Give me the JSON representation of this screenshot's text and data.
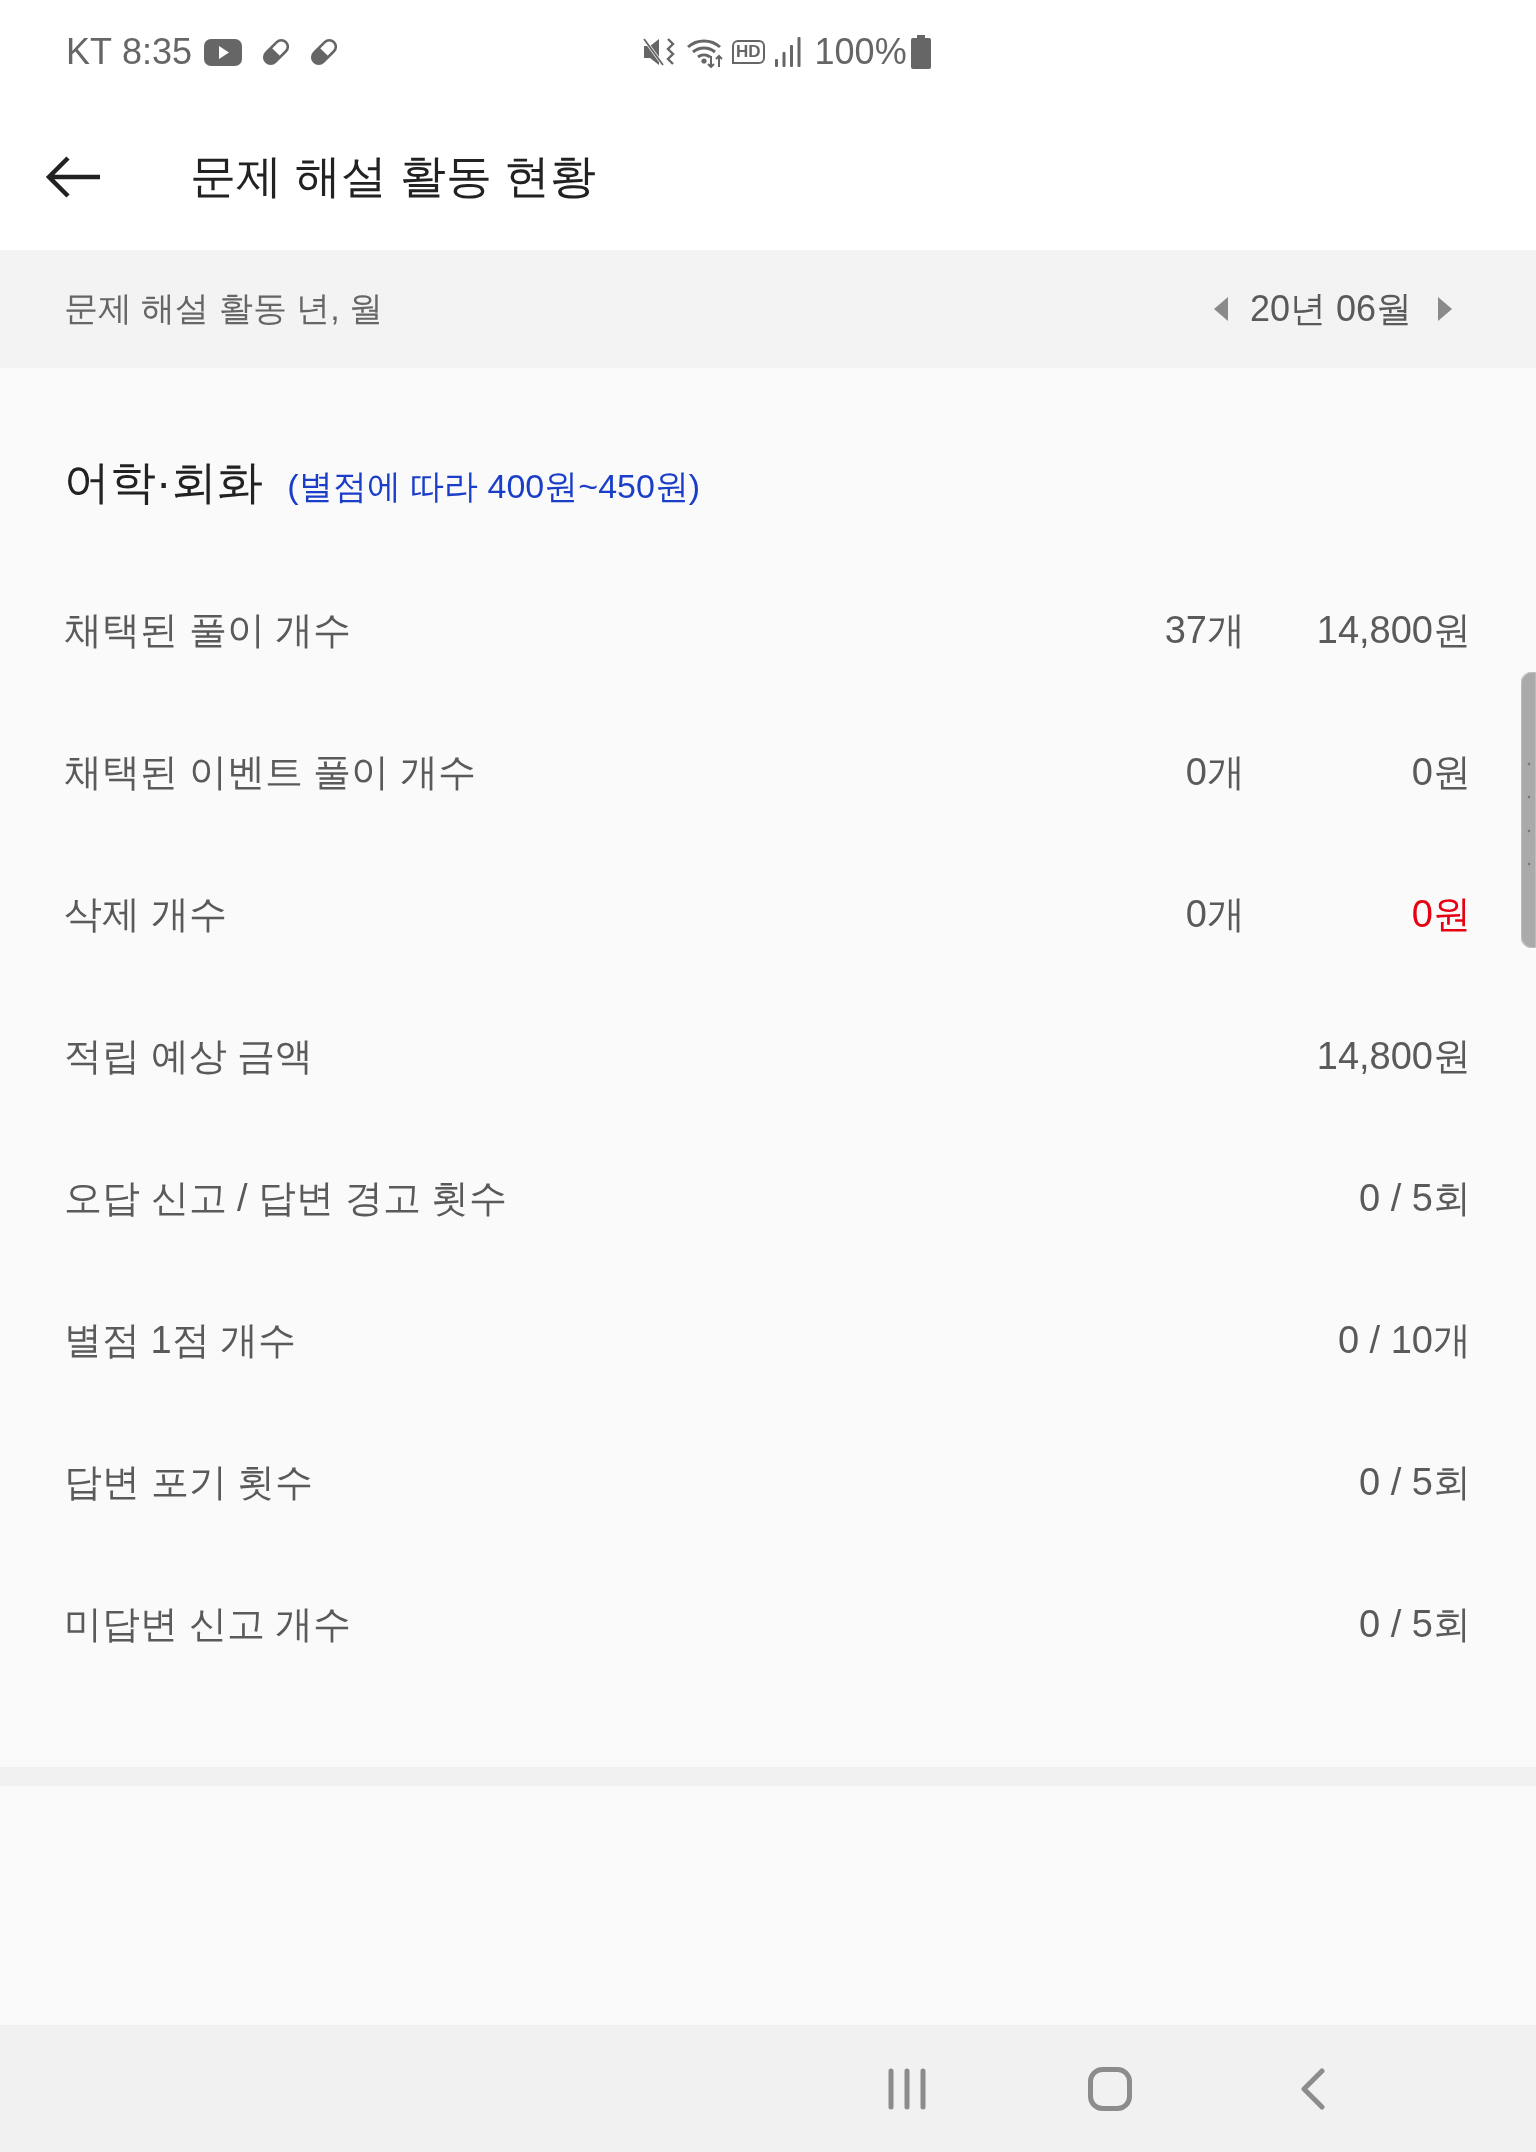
{
  "status_bar": {
    "carrier": "KT",
    "time": "8:35",
    "network_badge": "HD",
    "battery": "100%"
  },
  "header": {
    "title": "문제 해설 활동 현황"
  },
  "period": {
    "label": "문제 해설 활동 년, 월",
    "value": "20년 06월"
  },
  "section": {
    "title": "어학·회화",
    "note": "(별점에 따라 400원~450원)"
  },
  "rows": [
    {
      "kind": "count_amount",
      "label": "채택된 풀이 개수",
      "count": "37개",
      "amount": "14,800원",
      "warning": false
    },
    {
      "kind": "count_amount",
      "label": "채택된 이벤트 풀이 개수",
      "count": "0개",
      "amount": "0원",
      "warning": false
    },
    {
      "kind": "count_amount",
      "label": "삭제 개수",
      "count": "0개",
      "amount": "0원",
      "warning": true
    },
    {
      "kind": "value",
      "label": "적립 예상 금액",
      "value": "14,800원",
      "warning": false
    },
    {
      "kind": "value",
      "label": "오답 신고 / 답변 경고 횟수",
      "value": "0 / 5회",
      "warning": false
    },
    {
      "kind": "value",
      "label": "별점 1점 개수",
      "value": "0 / 10개",
      "warning": false
    },
    {
      "kind": "value",
      "label": "답변 포기 횟수",
      "value": "0 / 5회",
      "warning": false
    },
    {
      "kind": "value",
      "label": "미답변 신고 개수",
      "value": "0 / 5회",
      "warning": false
    }
  ]
}
